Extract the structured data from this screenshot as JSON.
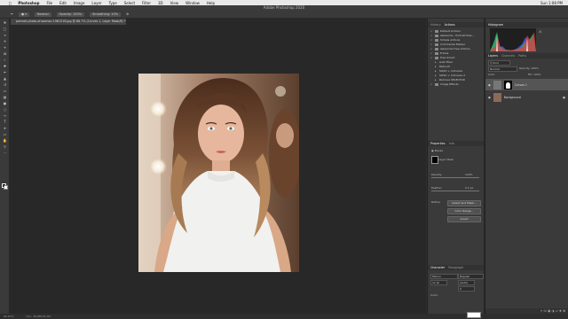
{
  "menubar": {
    "app": "Photoshop",
    "items": [
      "File",
      "Edit",
      "Image",
      "Layer",
      "Type",
      "Select",
      "Filter",
      "3D",
      "View",
      "Window",
      "Help"
    ],
    "clock": "Sun 1:08 PM"
  },
  "window_title": "Adobe Photoshop 2020",
  "options_bar": {
    "mode": "Normal",
    "opacity": "Opacity: 100%",
    "smoothing": "Smoothing: 10%"
  },
  "document_tab": "portrait-photo-of-woman-1961516.jpg @ 66.7% (Curves 1, Layer Mask/8) *",
  "status": {
    "zoom": "66.67%",
    "doc": "Doc: 39.6M/79.1M"
  },
  "panels": {
    "history_tab": "History",
    "actions_tab": "Actions",
    "histogram_tab": "Histogram",
    "layers_tabs": [
      "Layers",
      "Channels",
      "Paths"
    ],
    "properties_tabs": [
      "Properties",
      "Info"
    ],
    "character_tabs": [
      "Character",
      "Paragraph"
    ]
  },
  "actions": [
    {
      "label": "Default Actions",
      "kind": "folder"
    },
    {
      "label": "Awesome - Portrait Pres...",
      "kind": "folder"
    },
    {
      "label": "Simple Actions",
      "kind": "folder"
    },
    {
      "label": "Commands Meteor",
      "kind": "folder"
    },
    {
      "label": "Awesome Free Actions",
      "kind": "folder"
    },
    {
      "label": "Frame",
      "kind": "folder"
    },
    {
      "label": "Free Smart",
      "kind": "folder"
    },
    {
      "label": "Auto Fiber",
      "kind": "step"
    },
    {
      "label": "Retouch",
      "kind": "step"
    },
    {
      "label": "SOSO + Inclusive",
      "kind": "step"
    },
    {
      "label": "SOSO + Inclusive 2",
      "kind": "step"
    },
    {
      "label": "Remove SELECTOR",
      "kind": "step"
    },
    {
      "label": "Image Effects",
      "kind": "folder"
    }
  ],
  "properties": {
    "type": "Masks",
    "layer_mask": "Layer Mask",
    "density_label": "Density:",
    "density_value": "100%",
    "feather_label": "Feather:",
    "feather_value": "0.0 px",
    "refine_label": "Refine:",
    "buttons": [
      "Select and Mask...",
      "Color Range...",
      "Invert"
    ]
  },
  "layers": {
    "blend_mode": "Normal",
    "opacity": "Opacity: 100%",
    "fill": "Fill: 100%",
    "lock": "Lock:",
    "kind": "Kind",
    "rows": [
      {
        "name": "Curves 1",
        "selected": true
      },
      {
        "name": "Background",
        "selected": false
      }
    ]
  },
  "character": {
    "font": "Minion",
    "style": "Regular",
    "size": "12 pt",
    "leading": "(Auto)",
    "tracking": "0",
    "color_label": "Color:"
  }
}
